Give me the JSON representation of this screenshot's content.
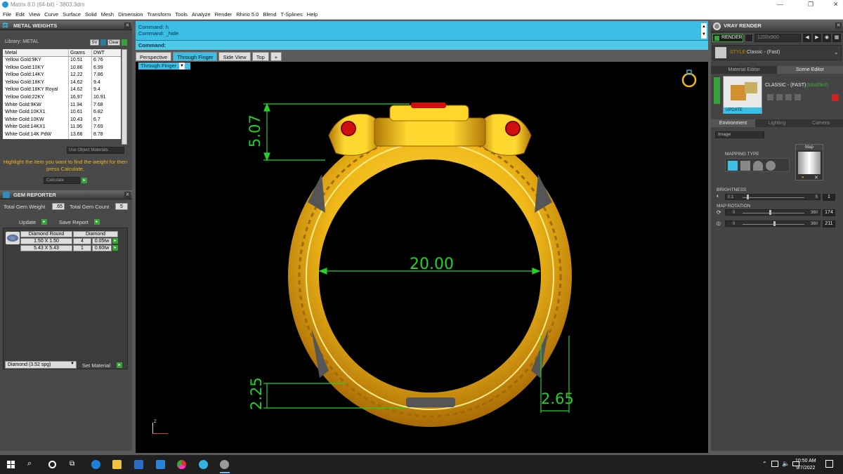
{
  "window": {
    "title": "Matrix 8.0 (64-bit) - 3803.3dm"
  },
  "menu": [
    "File",
    "Edit",
    "View",
    "Curve",
    "Surface",
    "Solid",
    "Mesh",
    "Dimension",
    "Transform",
    "Tools",
    "Analyze",
    "Render",
    "Rhino 5.0",
    "Blend",
    "T-Splines",
    "Help"
  ],
  "metal_weights": {
    "title": "METAL WEIGHTS",
    "library_label": "Library: METAL",
    "sv_label": "SV",
    "clear_label": "Clear",
    "columns": [
      "Metal",
      "Grams",
      "DWT"
    ],
    "rows": [
      [
        "Yellow Gold:9KY",
        "10.51",
        "6.76"
      ],
      [
        "Yellow Gold:10KY",
        "10.86",
        "6.99"
      ],
      [
        "Yellow Gold:14KY",
        "12.22",
        "7.86"
      ],
      [
        "Yellow Gold:18KY",
        "14.62",
        "9.4"
      ],
      [
        "Yellow Gold:18KY Royal",
        "14.62",
        "9.4"
      ],
      [
        "Yellow Gold:22KY",
        "16.97",
        "10.91"
      ],
      [
        "White Gold:9KW",
        "11.94",
        "7.68"
      ],
      [
        "White Gold:10KX1",
        "10.61",
        "6.82"
      ],
      [
        "White Gold:10KW",
        "10.43",
        "6.7"
      ],
      [
        "White Gold:14KX1",
        "11.96",
        "7.69"
      ],
      [
        "White Gold:14K PdW",
        "13.66",
        "8.78"
      ]
    ],
    "use_object_materials": "Use Object Materials",
    "hint": "Highlight the item you want to find the weight for then press Calculate.",
    "calculate": "Calculate"
  },
  "gem_reporter": {
    "title": "GEM REPORTER",
    "total_weight_label": "Total Gem Weight",
    "total_weight_value": ".65",
    "total_count_label": "Total Gem Count",
    "total_count_value": "5",
    "update": "Update",
    "save_report": "Save Report",
    "header": [
      "Diamond Round",
      "Diamond"
    ],
    "rows": [
      [
        "1.50 X 1.50",
        "4",
        "0.05tw"
      ],
      [
        "5.43 X 5.43",
        "1",
        "0.60tw"
      ]
    ],
    "material_select": "Diamond   (3.52 spg)",
    "set_material": "Set Material"
  },
  "command": {
    "history": [
      "Command: h",
      "Command: _hide"
    ],
    "prompt": "Command:"
  },
  "view_tabs": [
    "Perspective",
    "Through Finger",
    "Side View",
    "Top",
    "+"
  ],
  "active_view": "Through Finger",
  "dimensions": {
    "inner_diameter": "20.00",
    "top_height": "5.07",
    "bottom_height": "2.25",
    "side_width": "2.65"
  },
  "axis_label": "Z",
  "vray": {
    "title": "VRAY RENDER",
    "render": "RENDER",
    "resolution": "1200x900",
    "style_label": "STYLE:",
    "style_value": "Classic - (Fast)",
    "tabs": [
      "Material Editor",
      "Scene Editor"
    ],
    "scene_name": "CLASSIC - (FAST)",
    "modified": "(Modified)",
    "update": "UPDATE",
    "env_tabs": [
      "Environment",
      "Lighting",
      "Camera"
    ],
    "env_select": "Image",
    "mapping_type": "MAPPING TYPE",
    "map_label": "Map",
    "brightness_label": "BRIGHTNESS",
    "brightness_min": "0.1",
    "brightness_max": "5",
    "brightness_value": "1",
    "map_rotation_label": "MAP ROTATION",
    "rot1_min": "0",
    "rot1_max": "360",
    "rot1_value": "174",
    "rot2_min": "0",
    "rot2_max": "360",
    "rot2_value": "211"
  },
  "taskbar": {
    "time": "10:50 AM",
    "date": "9/7/2022"
  },
  "colors": {
    "accent": "#3bbfe5",
    "gold": "#f0c020",
    "dimension": "#22d22a",
    "gem": "#d01010"
  }
}
